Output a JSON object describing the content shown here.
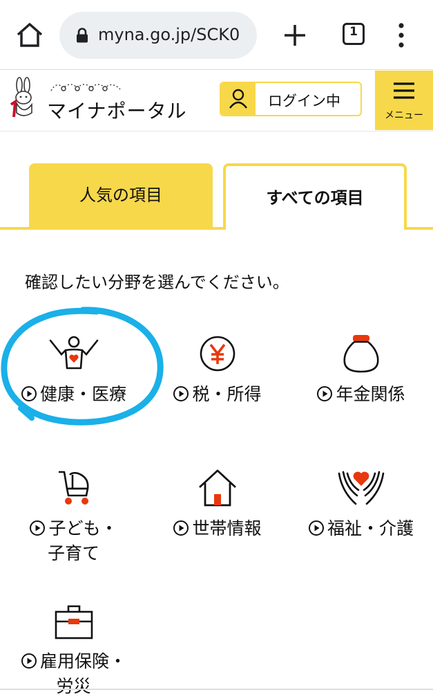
{
  "browser": {
    "url": "myna.go.jp/SCK0",
    "tab_count": "1"
  },
  "header": {
    "logo_text": "マイナポータル",
    "login_status": "ログイン中",
    "menu_label": "メニュー"
  },
  "tabs": [
    {
      "label": "人気の項目",
      "active": false
    },
    {
      "label": "すべての項目",
      "active": true
    }
  ],
  "prompt": "確認したい分野を選んでください。",
  "categories": [
    {
      "label": "健康・医療",
      "icon": "health-icon"
    },
    {
      "label": "税・所得",
      "icon": "yen-icon"
    },
    {
      "label": "年金関係",
      "icon": "pension-pouch-icon"
    },
    {
      "label_line1": "子ども・",
      "label_line2": "子育て",
      "icon": "stroller-icon"
    },
    {
      "label": "世帯情報",
      "icon": "house-icon"
    },
    {
      "label": "福祉・介護",
      "icon": "care-hands-icon"
    },
    {
      "label_line1": "雇用保険・",
      "label_line2": "労災",
      "icon": "briefcase-icon"
    }
  ],
  "colors": {
    "accent_yellow": "#f7d84a",
    "icon_red": "#e8380d",
    "highlight_blue": "#1ab0e8"
  }
}
